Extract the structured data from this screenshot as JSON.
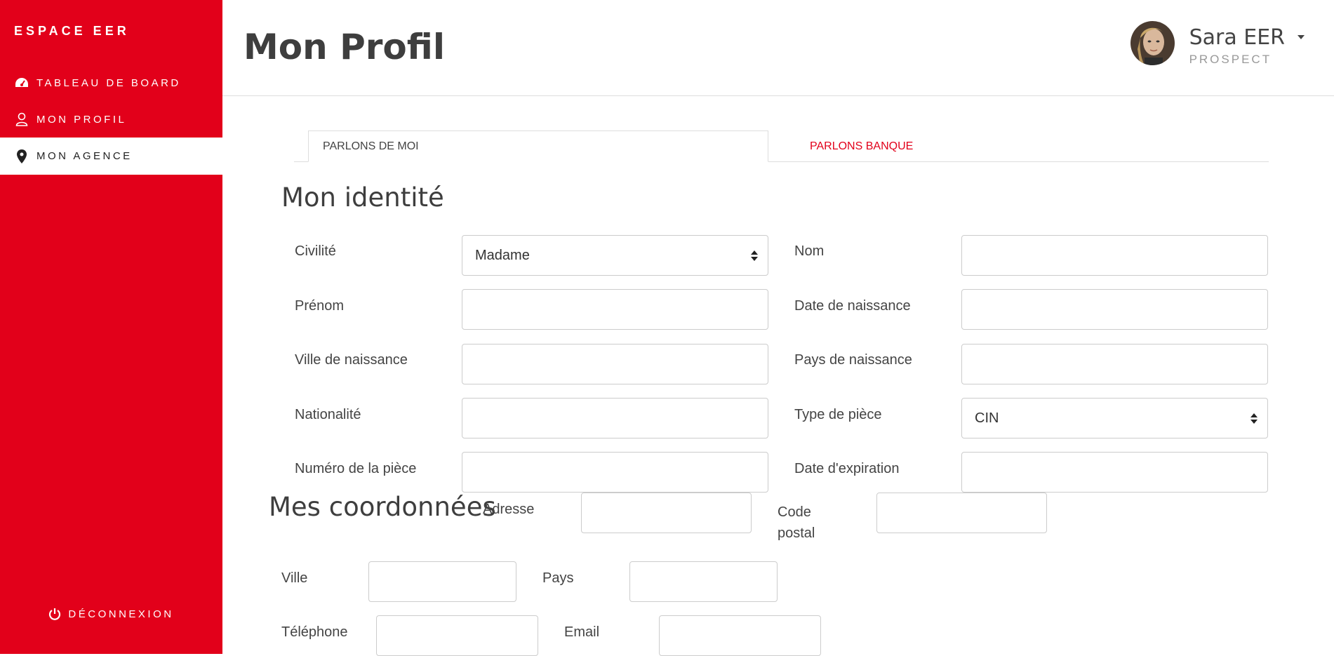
{
  "sidebar": {
    "brand": "ESPACE EER",
    "items": [
      {
        "label": "TABLEAU DE BOARD",
        "icon": "dashboard-icon"
      },
      {
        "label": "MON PROFIL",
        "icon": "user-icon"
      },
      {
        "label": "MON AGENCE",
        "icon": "map-pin-icon"
      }
    ],
    "logout": {
      "label": "DÉCONNEXION",
      "icon": "power-icon"
    }
  },
  "header": {
    "title": "Mon Profil",
    "user": {
      "name": "Sara EER",
      "role": "PROSPECT"
    }
  },
  "tabs": [
    {
      "label": "PARLONS DE MOI",
      "active": true
    },
    {
      "label": "PARLONS BANQUE",
      "active": false
    }
  ],
  "identity": {
    "title": "Mon identité",
    "fields": {
      "civilite": {
        "label": "Civilité",
        "value": "Madame"
      },
      "nom": {
        "label": "Nom",
        "value": ""
      },
      "prenom": {
        "label": "Prénom",
        "value": ""
      },
      "date_naissance": {
        "label": "Date de naissance",
        "value": ""
      },
      "ville_naissance": {
        "label": "Ville de naissance",
        "value": ""
      },
      "pays_naissance": {
        "label": "Pays de naissance",
        "value": ""
      },
      "nationalite": {
        "label": "Nationalité",
        "value": ""
      },
      "type_piece": {
        "label": "Type de pièce",
        "value": "CIN"
      },
      "numero_piece": {
        "label": "Numéro de la pièce",
        "value": ""
      },
      "date_expiration": {
        "label": "Date d'expiration",
        "value": ""
      }
    }
  },
  "contact": {
    "title": "Mes coordonnées",
    "fields": {
      "adresse": {
        "label": "Adresse",
        "value": ""
      },
      "code_postal": {
        "label": "Code postal",
        "value": ""
      },
      "ville": {
        "label": "Ville",
        "value": ""
      },
      "pays": {
        "label": "Pays",
        "value": ""
      },
      "telephone": {
        "label": "Téléphone",
        "value": ""
      },
      "email": {
        "label": "Email",
        "value": ""
      }
    }
  },
  "colors": {
    "brand": "#e2001a",
    "text": "#444444"
  }
}
